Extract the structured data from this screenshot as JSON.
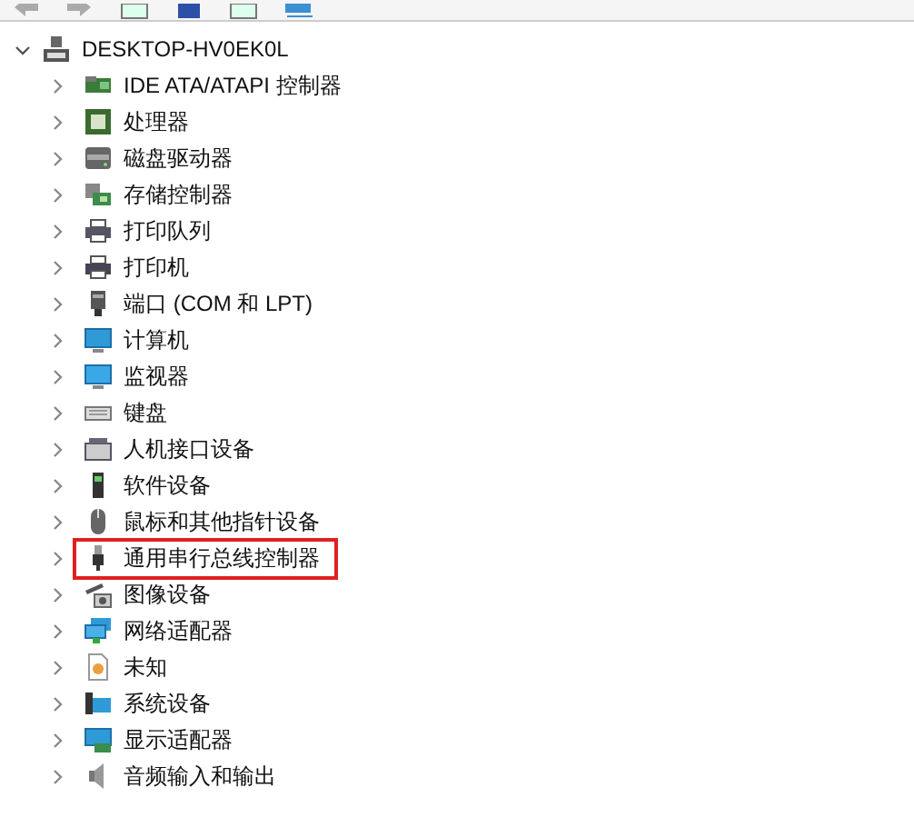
{
  "tree": {
    "label": "DESKTOP-HV0EK0L",
    "expanded": true,
    "children": [
      {
        "label": "IDE ATA/ATAPI 控制器",
        "expanded": false,
        "highlighted": false
      },
      {
        "label": "处理器",
        "expanded": false,
        "highlighted": false
      },
      {
        "label": "磁盘驱动器",
        "expanded": false,
        "highlighted": false
      },
      {
        "label": "存储控制器",
        "expanded": false,
        "highlighted": false
      },
      {
        "label": "打印队列",
        "expanded": false,
        "highlighted": false
      },
      {
        "label": "打印机",
        "expanded": false,
        "highlighted": false
      },
      {
        "label": "端口 (COM 和 LPT)",
        "expanded": false,
        "highlighted": false
      },
      {
        "label": "计算机",
        "expanded": false,
        "highlighted": false
      },
      {
        "label": "监视器",
        "expanded": false,
        "highlighted": false
      },
      {
        "label": "键盘",
        "expanded": false,
        "highlighted": false
      },
      {
        "label": "人机接口设备",
        "expanded": false,
        "highlighted": false
      },
      {
        "label": "软件设备",
        "expanded": false,
        "highlighted": false
      },
      {
        "label": "鼠标和其他指针设备",
        "expanded": false,
        "highlighted": false
      },
      {
        "label": "通用串行总线控制器",
        "expanded": false,
        "highlighted": true
      },
      {
        "label": "图像设备",
        "expanded": false,
        "highlighted": false
      },
      {
        "label": "网络适配器",
        "expanded": false,
        "highlighted": false
      },
      {
        "label": "未知",
        "expanded": false,
        "highlighted": false
      },
      {
        "label": "系统设备",
        "expanded": false,
        "highlighted": false
      },
      {
        "label": "显示适配器",
        "expanded": false,
        "highlighted": false
      },
      {
        "label": "音频输入和输出",
        "expanded": false,
        "highlighted": false
      }
    ]
  }
}
